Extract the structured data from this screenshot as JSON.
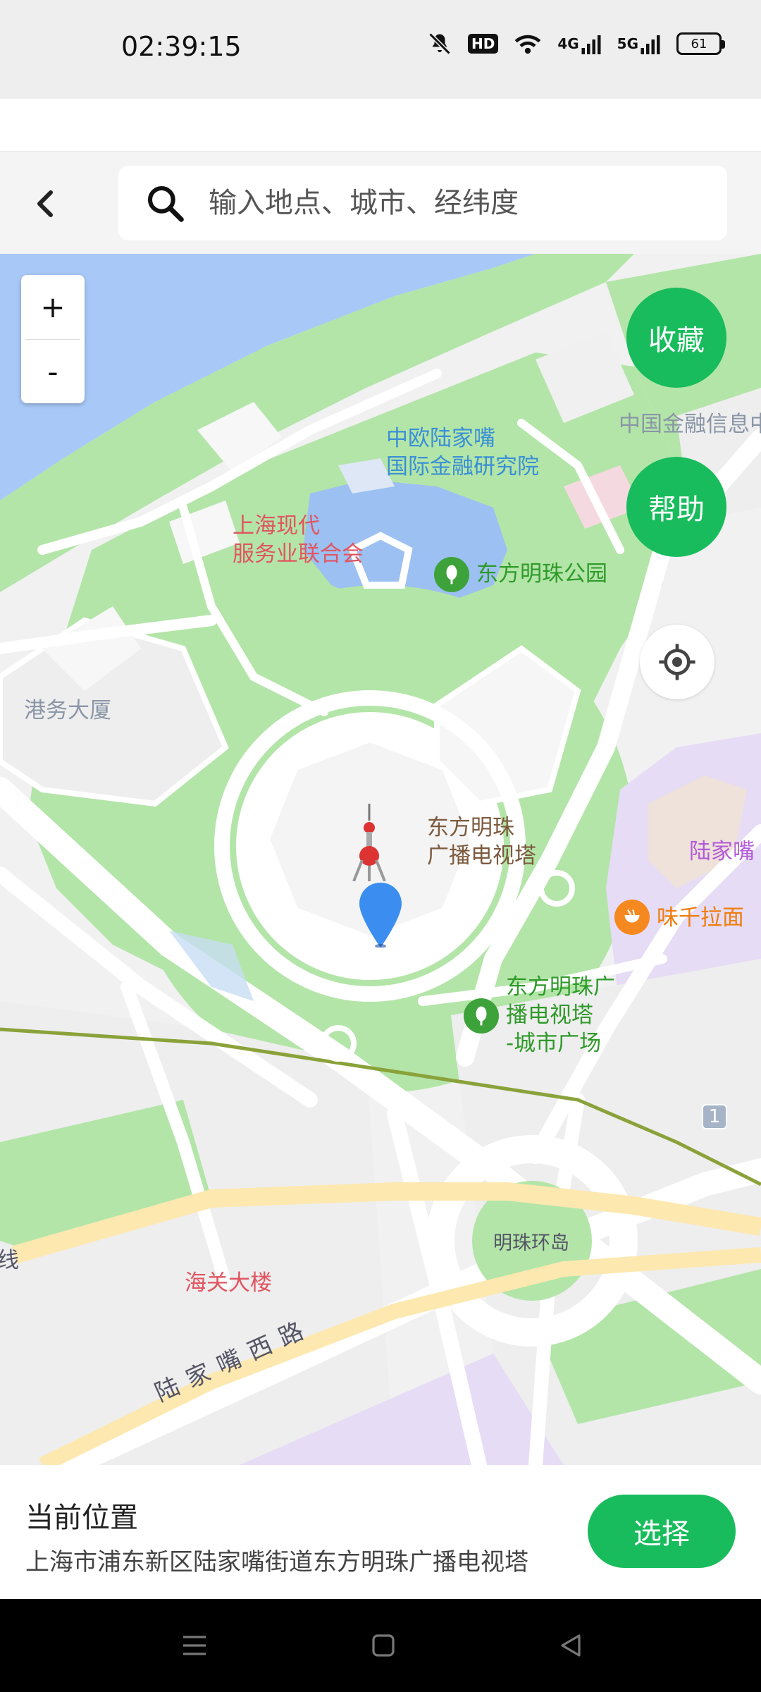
{
  "status_bar": {
    "time": "02:39:15",
    "hd_label": "HD",
    "net1_label": "4G",
    "net2_label": "5G",
    "battery": "61",
    "icons": [
      "mute-icon",
      "hd-icon",
      "wifi-icon",
      "signal-4g-icon",
      "signal-5g-icon",
      "battery-icon"
    ]
  },
  "header": {
    "back_icon": "chevron-left-icon",
    "search_icon": "search-icon",
    "search_placeholder": "输入地点、城市、经纬度"
  },
  "map": {
    "zoom_in": "+",
    "zoom_out": "-",
    "favorite_button": "收藏",
    "help_button": "帮助",
    "locate_icon": "crosshair-icon",
    "labels": {
      "ceibs_line1": "中欧陆家嘴",
      "ceibs_line2": "国际金融研究院",
      "finance_info": "中国金融信息中",
      "services_line1": "上海现代",
      "services_line2": "服务业联合会",
      "park": "东方明珠公园",
      "port_building": "港务大厦",
      "tower_line1": "东方明珠",
      "tower_line2": "广播电视塔",
      "lujiazui": "陆家嘴",
      "ajisen": "味千拉面",
      "plaza_line1": "东方明珠广",
      "plaza_line2": "播电视塔",
      "plaza_line3": "-城市广场",
      "metro_badge": "1",
      "roundabout": "明珠环岛",
      "customs": "海关大楼",
      "line_frag": "线",
      "road": "陆家嘴西路"
    },
    "colors": {
      "water": "#a8c8f8",
      "green": "#b3e5a8",
      "road": "#ffffff",
      "block": "#eeeeee",
      "highway": "#fde8b0",
      "purple_area": "#e6dcf5",
      "metro_line": "#8aa23a",
      "pin": "#3b8ef0"
    }
  },
  "bottom": {
    "title": "当前位置",
    "address": "上海市浦东新区陆家嘴街道东方明珠广播电视塔",
    "select_button": "选择"
  },
  "nav_bar": {
    "icons": [
      "menu-icon",
      "home-icon",
      "back-triangle-icon"
    ]
  }
}
